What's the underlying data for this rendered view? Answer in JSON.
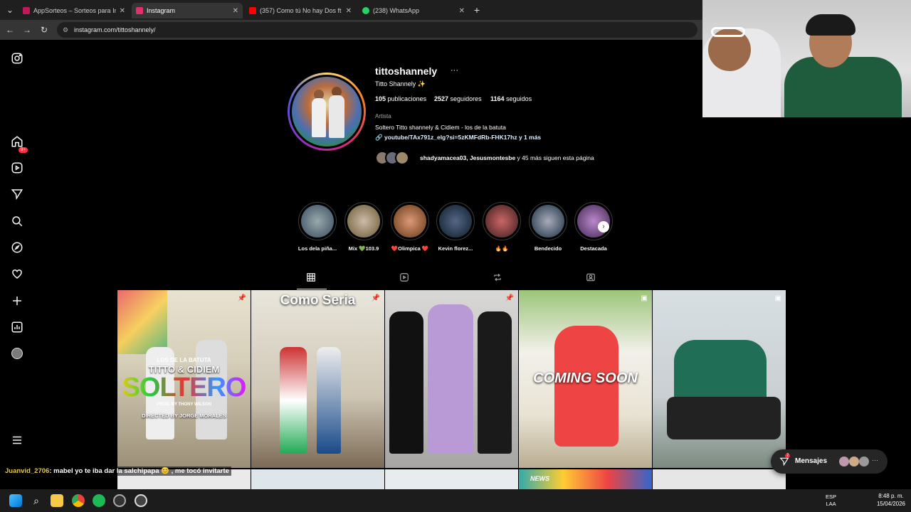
{
  "browser": {
    "tabs": [
      {
        "title": "AppSorteos – Sorteos para Insta",
        "color": "#c2185b"
      },
      {
        "title": "Instagram",
        "color": "#e1306c"
      },
      {
        "title": "(357) Como tú No hay Dos ft Cid",
        "color": "#ff0000"
      },
      {
        "title": "(238) WhatsApp",
        "color": "#25d366"
      }
    ],
    "url": "instagram.com/tittoshannely/"
  },
  "sidebar": {
    "notifications_badge": "9+"
  },
  "profile": {
    "username": "tittoshannely",
    "more": "···",
    "display_name": "Titto Shannely ✨",
    "posts": "105",
    "posts_label": "publicaciones",
    "followers": "2527",
    "followers_label": "seguidores",
    "following": "1164",
    "following_label": "seguidos",
    "category": "Artista",
    "bio": "Soltero Titto shannely & Cidiem - los de la batuta",
    "link": "youtube/TAx791z_elg?si=5zKMFdRb-FHK17hz y 1 más",
    "followed_by_names": "shadyamacea03, Jesusmontesbe",
    "followed_by_rest": " y 45 más siguen esta página"
  },
  "highlights": [
    {
      "label": "Los dela piña...",
      "color": "#5a6a7a"
    },
    {
      "label": "Mix 💚103.9",
      "color": "#8a7a5a"
    },
    {
      "label": "❤️Olimpica ❤️",
      "color": "#b85a3a"
    },
    {
      "label": "Kevin florez...",
      "color": "#2a3a5a"
    },
    {
      "label": "🔥🔥",
      "color": "#9a3a3a"
    },
    {
      "label": "Bendecido",
      "color": "#6a7a8a"
    },
    {
      "label": "Destacada",
      "color": "#8a5a9a"
    }
  ],
  "posts": [
    {
      "line1": "LOS DE LA BATUTA",
      "line2": "TITTO & CIDIEM",
      "line3": "SOLTERO",
      "line4": "PROD. BY THONY WILSON",
      "line5": "DIRECTED BY JORGE MORALES"
    },
    {
      "line1": "Como Seria"
    },
    {
      "line1": ""
    },
    {
      "line1": "COMING SOON"
    },
    {
      "line1": ""
    }
  ],
  "second_row": [
    {
      "label": ""
    },
    {
      "label": ""
    },
    {
      "label": ""
    },
    {
      "label": "NEWS"
    },
    {
      "label": ""
    }
  ],
  "messages": {
    "label": "Mensajes",
    "count": "7"
  },
  "chat": {
    "user": "Juanvid_2706",
    "message": ": mabel yo te iba dar la salchipapa 😊 , me tocó invitarte"
  },
  "taskbar": {
    "lang1": "ESP",
    "lang2": "LAA",
    "time": "8:48 p. m.",
    "date": "15/04/2026"
  }
}
